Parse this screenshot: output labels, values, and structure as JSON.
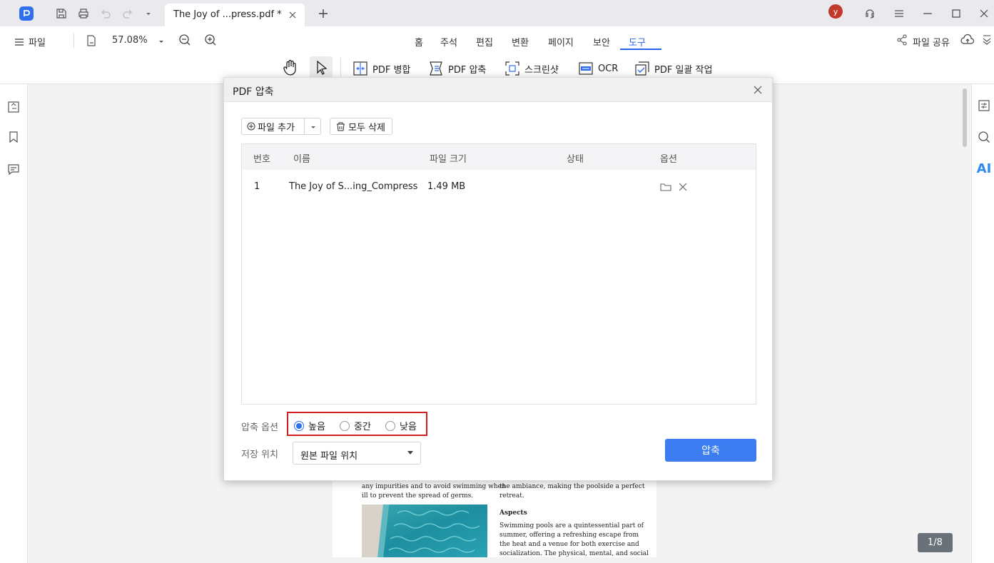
{
  "titlebar": {
    "tab_title": "The Joy of ...press.pdf *",
    "avatar_letter": "y"
  },
  "menubar": {
    "file_label": "파일",
    "zoom": "57.08%",
    "tabs": [
      "홈",
      "주석",
      "편집",
      "변환",
      "페이지",
      "보안",
      "도구"
    ],
    "active_tab": "도구",
    "share_label": "파일 공유"
  },
  "tools": {
    "merge": "PDF 병합",
    "compress": "PDF 압축",
    "screenshot": "스크린샷",
    "ocr": "OCR",
    "batch": "PDF 일괄 작업"
  },
  "right_panel": {
    "ai_label": "AI"
  },
  "dialog": {
    "title": "PDF 압축",
    "add_file": "파일 추가",
    "delete_all": "모두 삭제",
    "columns": [
      "번호",
      "이름",
      "파일 크기",
      "상태",
      "옵션"
    ],
    "rows": [
      {
        "no": "1",
        "name": "The Joy of S...ing_Compress",
        "size": "1.49 MB",
        "status": ""
      }
    ],
    "compress_option_label": "압축 옵션",
    "levels": [
      "높음",
      "중간",
      "낮음"
    ],
    "selected_level": "높음",
    "save_location_label": "저장 위치",
    "save_location_value": "원본 파일 위치",
    "compress_button": "압축"
  },
  "document": {
    "left_lines": [
      "any impurities and to avoid swimming when",
      "ill to prevent the spread of germs."
    ],
    "right_lines_top": [
      "the ambiance, making the poolside a perfect",
      "retreat."
    ],
    "heading": "Aspects",
    "right_lines_body": [
      "Swimming pools are a quintessential part of",
      "summer, offering a refreshing escape from",
      "the heat and a venue for both exercise and",
      "socialization. The physical, mental, and social"
    ]
  },
  "page_counter": "1/8",
  "colors": {
    "accent": "#3b7cf0",
    "highlight_border": "#d21f1f"
  }
}
